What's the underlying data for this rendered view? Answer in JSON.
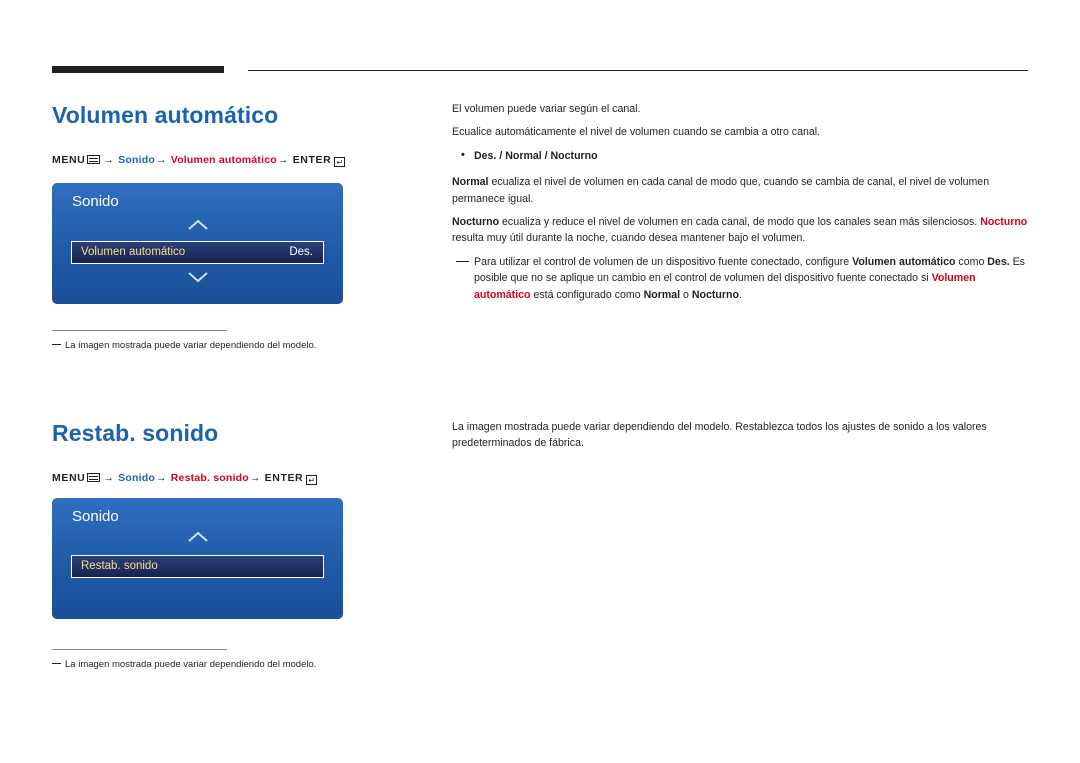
{
  "sections": [
    {
      "title": "Volumen automático",
      "path": {
        "menu_label": "MENU",
        "menu_icon": "menu-grid-icon",
        "arrow": "→",
        "item1": "Sonido",
        "item2": "Volumen automático",
        "enter_label": "ENTER",
        "enter_icon": "enter-key-icon"
      },
      "menubox": {
        "title": "Sonido",
        "up_icon": "chevron-up-icon",
        "down_icon": "chevron-down-icon",
        "row_label": "Volumen automático",
        "row_value": "Des."
      },
      "footnote": "La imagen mostrada puede variar dependiendo del modelo."
    },
    {
      "title": "Restab. sonido",
      "path": {
        "menu_label": "MENU",
        "menu_icon": "menu-grid-icon",
        "arrow": "→",
        "item1": "Sonido",
        "item2": "Restab. sonido",
        "enter_label": "ENTER",
        "enter_icon": "enter-key-icon"
      },
      "menubox": {
        "title": "Sonido",
        "up_icon": "chevron-up-icon",
        "row_label": "Restab. sonido",
        "row_value": ""
      },
      "footnote": "La imagen mostrada puede variar dependiendo del modelo."
    }
  ],
  "body1": {
    "p1": "El volumen puede variar según el canal.",
    "p2": "Ecualice automáticamente el nivel de volumen cuando se cambia a otro canal.",
    "bullet": "Des. / Normal / Nocturno",
    "p3_bold": "Normal",
    "p3_rest": " ecualiza el nivel de volumen en cada canal de modo que, cuando se cambia de canal, el nivel de volumen permanece igual.",
    "p4_bold1": "Nocturno",
    "p4_mid": " ecualiza y reduce el nivel de volumen en cada canal, de modo que los canales sean más silenciosos. ",
    "p4_bold2": "Nocturno",
    "p4_rest": " resulta muy útil durante la noche, cuando desea mantener bajo el volumen.",
    "note_a": "Para utilizar el control de volumen de un dispositivo fuente conectado, configure ",
    "note_b": "Volumen automático",
    "note_c": " como ",
    "note_d": "Des.",
    "note_e": " Es posible que no se aplique un cambio en el control de volumen del dispositivo fuente conectado si ",
    "note_f": "Volumen automático",
    "note_g": " está configurado como ",
    "note_h": "Normal",
    "note_i": " o ",
    "note_j": "Nocturno",
    "note_k": "."
  },
  "body2": {
    "p1": "La imagen mostrada puede variar dependiendo del modelo. Restablezca todos los ajustes de sonido a los valores predeterminados de fábrica."
  }
}
